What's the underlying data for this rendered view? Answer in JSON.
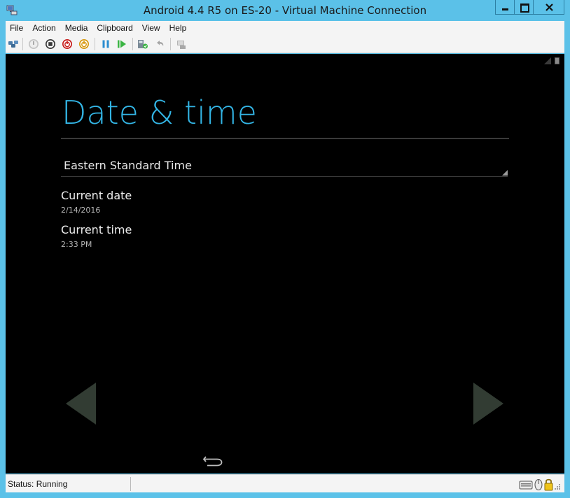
{
  "window": {
    "title": "Android 4.4 R5 on ES-20 - Virtual Machine Connection",
    "icon": "vm-connection-icon",
    "controls": [
      "minimize-icon",
      "maximize-icon",
      "close-icon"
    ]
  },
  "menu": {
    "items": [
      {
        "label": "File"
      },
      {
        "label": "Action"
      },
      {
        "label": "Media"
      },
      {
        "label": "Clipboard"
      },
      {
        "label": "View"
      },
      {
        "label": "Help"
      }
    ]
  },
  "toolbar": {
    "buttons": [
      "ctrl-alt-del-icon",
      "start-icon",
      "turn-off-icon",
      "shut-down-icon",
      "save-icon",
      "pause-icon",
      "resume-icon",
      "checkpoint-icon",
      "revert-icon",
      "enhanced-session-icon"
    ]
  },
  "android": {
    "page_title": "Date & time",
    "timezone": "Eastern Standard Time",
    "prefs": [
      {
        "title": "Current date",
        "summary": "2/14/2016"
      },
      {
        "title": "Current time",
        "summary": "2:33 PM"
      }
    ]
  },
  "statusbar": {
    "status": "Status: Running",
    "icons": [
      "keyboard-icon",
      "mouse-icon",
      "lock-icon"
    ]
  },
  "colors": {
    "titlebar": "#5bc1e8",
    "android_accent": "#33b5e5",
    "screen_bg": "#000000"
  }
}
